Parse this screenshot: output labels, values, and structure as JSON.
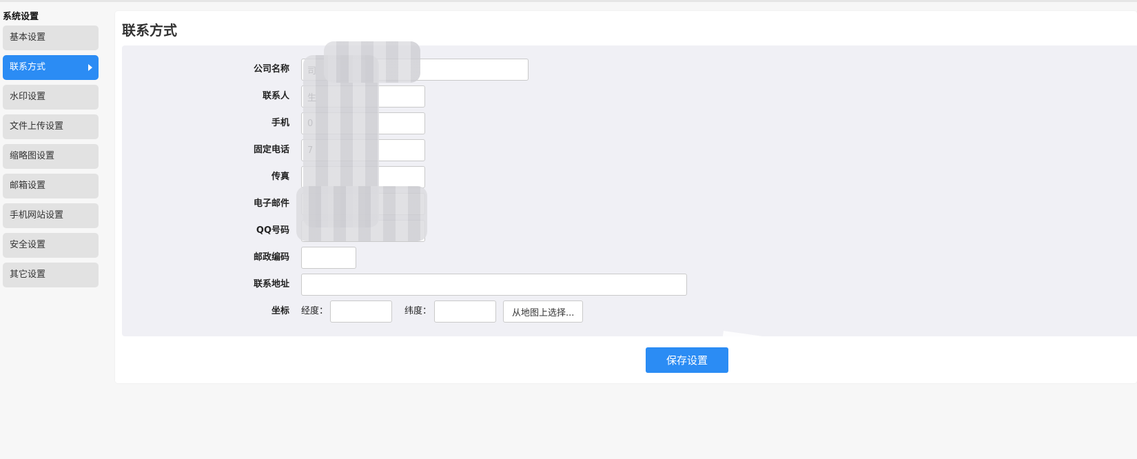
{
  "sidebar": {
    "title": "系统设置",
    "items": [
      {
        "label": "基本设置"
      },
      {
        "label": "联系方式"
      },
      {
        "label": "水印设置"
      },
      {
        "label": "文件上传设置"
      },
      {
        "label": "缩略图设置"
      },
      {
        "label": "邮箱设置"
      },
      {
        "label": "手机网站设置"
      },
      {
        "label": "安全设置"
      },
      {
        "label": "其它设置"
      }
    ],
    "active_item": "联系方式"
  },
  "main": {
    "title": "联系方式",
    "fields": {
      "company_name": {
        "label": "公司名称",
        "value": "司"
      },
      "contact_person": {
        "label": "联系人",
        "value": "生"
      },
      "mobile": {
        "label": "手机",
        "value": "0"
      },
      "phone": {
        "label": "固定电话",
        "value": "7"
      },
      "fax": {
        "label": "传真",
        "value": ""
      },
      "email": {
        "label": "电子邮件",
        "value": ""
      },
      "qq": {
        "label": "QQ号码",
        "value": ""
      },
      "postcode": {
        "label": "邮政编码",
        "value": ""
      },
      "address": {
        "label": "联系地址",
        "value": ""
      },
      "coordinates": {
        "label": "坐标",
        "longitude_label": "经度：",
        "longitude_value": "",
        "latitude_label": "纬度：",
        "latitude_value": "",
        "map_button_label": "从地图上选择..."
      }
    },
    "save_button_label": "保存设置"
  },
  "colors": {
    "accent": "#2b8cf4",
    "sidebar_item_bg": "#e2e2e2",
    "form_bg": "#f0f0f5",
    "page_bg": "#f7f7f7"
  }
}
